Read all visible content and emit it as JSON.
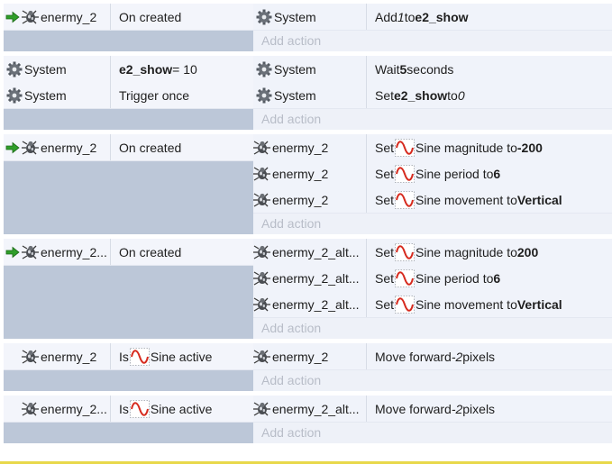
{
  "add_action_label": "Add action",
  "colors": {
    "condition_area": "#bcc7d8",
    "row_bg": "#f3f5fb",
    "add_action_text": "#b8bdc8",
    "arrow_green": "#2f9e2a",
    "sine_red": "#d62a1e"
  },
  "events": [
    {
      "has_trigger_arrow": true,
      "conditions": [
        {
          "object": "enermy_2",
          "icon": "bug-icon",
          "parts": [
            {
              "t": "On created"
            }
          ]
        }
      ],
      "actions": [
        {
          "object": "System",
          "icon": "gear-icon",
          "parts": [
            {
              "t": "Add "
            },
            {
              "t": "1",
              "s": "i"
            },
            {
              "t": " to "
            },
            {
              "t": "e2_show",
              "s": "b"
            }
          ]
        }
      ]
    },
    {
      "has_trigger_arrow": false,
      "conditions": [
        {
          "object": "System",
          "icon": "gear-icon",
          "parts": [
            {
              "t": "e2_show",
              "s": "b"
            },
            {
              "t": " = 10"
            }
          ]
        },
        {
          "object": "System",
          "icon": "gear-icon",
          "parts": [
            {
              "t": "Trigger once"
            }
          ]
        }
      ],
      "actions": [
        {
          "object": "System",
          "icon": "gear-icon",
          "parts": [
            {
              "t": "Wait "
            },
            {
              "t": "5",
              "s": "b"
            },
            {
              "t": " seconds"
            }
          ]
        },
        {
          "object": "System",
          "icon": "gear-icon",
          "parts": [
            {
              "t": "Set "
            },
            {
              "t": "e2_show",
              "s": "b"
            },
            {
              "t": " to "
            },
            {
              "t": "0",
              "s": "i"
            }
          ]
        }
      ]
    },
    {
      "has_trigger_arrow": true,
      "conditions": [
        {
          "object": "enermy_2",
          "icon": "bug-icon",
          "parts": [
            {
              "t": "On created"
            }
          ]
        }
      ],
      "actions": [
        {
          "object": "enermy_2",
          "icon": "bug-icon",
          "parts": [
            {
              "t": "Set "
            },
            {
              "sine": true
            },
            {
              "t": "Sine magnitude to "
            },
            {
              "t": "-200",
              "s": "b"
            }
          ]
        },
        {
          "object": "enermy_2",
          "icon": "bug-icon",
          "parts": [
            {
              "t": "Set "
            },
            {
              "sine": true
            },
            {
              "t": "Sine period to "
            },
            {
              "t": "6",
              "s": "b"
            }
          ]
        },
        {
          "object": "enermy_2",
          "icon": "bug-icon",
          "parts": [
            {
              "t": "Set "
            },
            {
              "sine": true
            },
            {
              "t": "Sine movement to "
            },
            {
              "t": "Vertical",
              "s": "b"
            }
          ]
        }
      ]
    },
    {
      "has_trigger_arrow": true,
      "conditions": [
        {
          "object": "enermy_2...",
          "icon": "bug-icon",
          "parts": [
            {
              "t": "On created"
            }
          ]
        }
      ],
      "actions": [
        {
          "object": "enermy_2_alt...",
          "icon": "bug-icon",
          "parts": [
            {
              "t": "Set "
            },
            {
              "sine": true
            },
            {
              "t": "Sine magnitude to "
            },
            {
              "t": "200",
              "s": "b"
            }
          ]
        },
        {
          "object": "enermy_2_alt...",
          "icon": "bug-icon",
          "parts": [
            {
              "t": "Set "
            },
            {
              "sine": true
            },
            {
              "t": "Sine period to "
            },
            {
              "t": "6",
              "s": "b"
            }
          ]
        },
        {
          "object": "enermy_2_alt...",
          "icon": "bug-icon",
          "parts": [
            {
              "t": "Set "
            },
            {
              "sine": true
            },
            {
              "t": "Sine movement to "
            },
            {
              "t": "Vertical",
              "s": "b"
            }
          ]
        }
      ]
    },
    {
      "has_trigger_arrow": false,
      "conditions": [
        {
          "object": "enermy_2",
          "icon": "bug-icon",
          "parts": [
            {
              "t": "Is "
            },
            {
              "sine": true
            },
            {
              "t": "Sine active"
            }
          ]
        }
      ],
      "actions": [
        {
          "object": "enermy_2",
          "icon": "bug-icon",
          "parts": [
            {
              "t": "Move forward "
            },
            {
              "t": "-2",
              "s": "i"
            },
            {
              "t": " pixels"
            }
          ]
        }
      ]
    },
    {
      "has_trigger_arrow": false,
      "conditions": [
        {
          "object": "enermy_2...",
          "icon": "bug-icon",
          "parts": [
            {
              "t": "Is "
            },
            {
              "sine": true
            },
            {
              "t": "Sine active"
            }
          ]
        }
      ],
      "actions": [
        {
          "object": "enermy_2_alt...",
          "icon": "bug-icon",
          "parts": [
            {
              "t": "Move forward "
            },
            {
              "t": "-2",
              "s": "i"
            },
            {
              "t": " pixels"
            }
          ]
        }
      ]
    }
  ]
}
